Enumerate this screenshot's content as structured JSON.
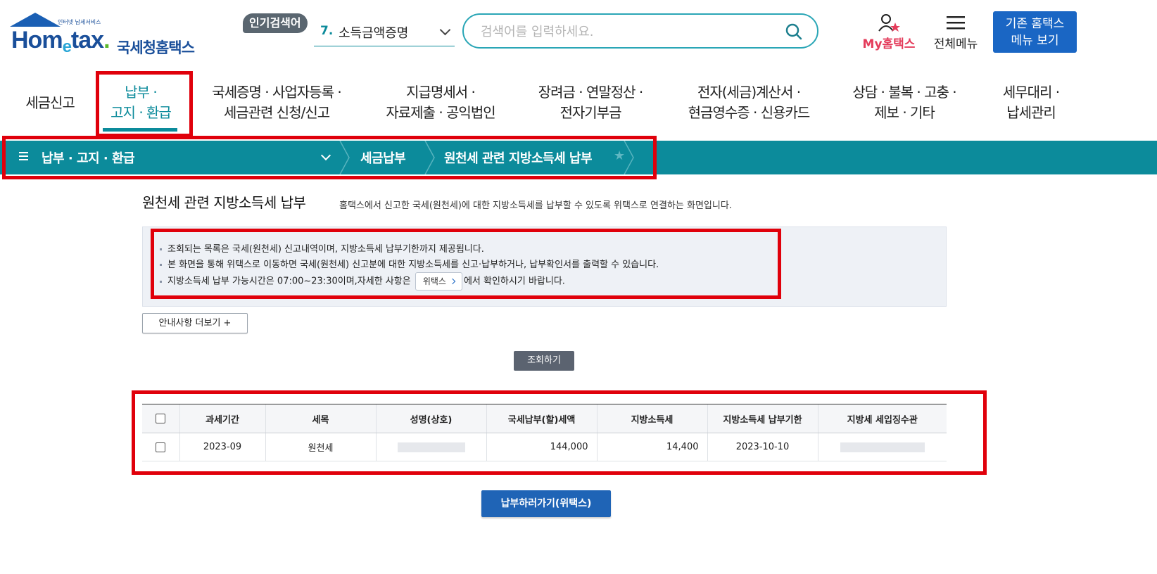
{
  "header": {
    "logo": {
      "small_text": "인터넷 납세서비스",
      "brand": "Hometax",
      "korean": "국세청홈택스"
    },
    "popular_badge": "인기검색어",
    "popular_select": {
      "number": "7.",
      "text": "소득금액증명"
    },
    "search": {
      "placeholder": "검색어를 입력하세요."
    },
    "my_hometax": "My홈택스",
    "all_menu": "전체메뉴",
    "old_menu_button": {
      "line1": "기존 홈택스",
      "line2": "메뉴 보기"
    }
  },
  "gnb": [
    {
      "line1": "세금신고",
      "line2": ""
    },
    {
      "line1": "납부 ·",
      "line2": "고지 · 환급"
    },
    {
      "line1": "국세증명 · 사업자등록 ·",
      "line2": "세금관련 신청/신고"
    },
    {
      "line1": "지급명세서 ·",
      "line2": "자료제출 · 공익법인"
    },
    {
      "line1": "장려금 · 연말정산 ·",
      "line2": "전자기부금"
    },
    {
      "line1": "전자(세금)계산서 ·",
      "line2": "현금영수증 · 신용카드"
    },
    {
      "line1": "상담 · 불복 · 고충 ·",
      "line2": "제보 · 기타"
    },
    {
      "line1": "세무대리 ·",
      "line2": "납세관리"
    }
  ],
  "location": {
    "menu": "납부 · 고지 · 환급",
    "crumb1": "세금납부",
    "crumb2": "원천세 관련 지방소득세 납부"
  },
  "page": {
    "title": "원천세 관련 지방소득세 납부",
    "description": "홈택스에서 신고한 국세(원천세)에 대한 지방소득세를 납부할 수 있도록 위택스로 연결하는 화면입니다."
  },
  "notice": {
    "line1": "조회되는 목록은 국세(원천세) 신고내역이며, 지방소득세 납부기한까지 제공됩니다.",
    "line2": "본 화면을 통해 위택스로 이동하면 국세(원천세) 신고분에 대한 지방소득세를 신고·납부하거나, 납부확인서를 출력할 수 있습니다.",
    "line3_before": "지방소득세 납부 가능시간은 07:00~23:30이며,자세한 사항은",
    "line3_link": "위택스",
    "line3_after": "에서 확인하시기 바랍니다."
  },
  "buttons": {
    "more": "안내사항 더보기 +",
    "query": "조회하기",
    "pay": "납부하러가기(위택스)"
  },
  "table": {
    "headers": [
      "과세기간",
      "세목",
      "성명(상호)",
      "국세납부(할)세액",
      "지방소득세",
      "지방소득세 납부기한",
      "지방세 세입징수관"
    ],
    "rows": [
      {
        "period": "2023-09",
        "tax_item": "원천세",
        "national_tax": "144,000",
        "local_tax": "14,400",
        "due_date": "2023-10-10"
      }
    ]
  },
  "colors": {
    "accent": "#0c8b9b",
    "highlight": "#e0000b",
    "primary_button": "#1f64b6",
    "brand": "#1a4f9a"
  }
}
